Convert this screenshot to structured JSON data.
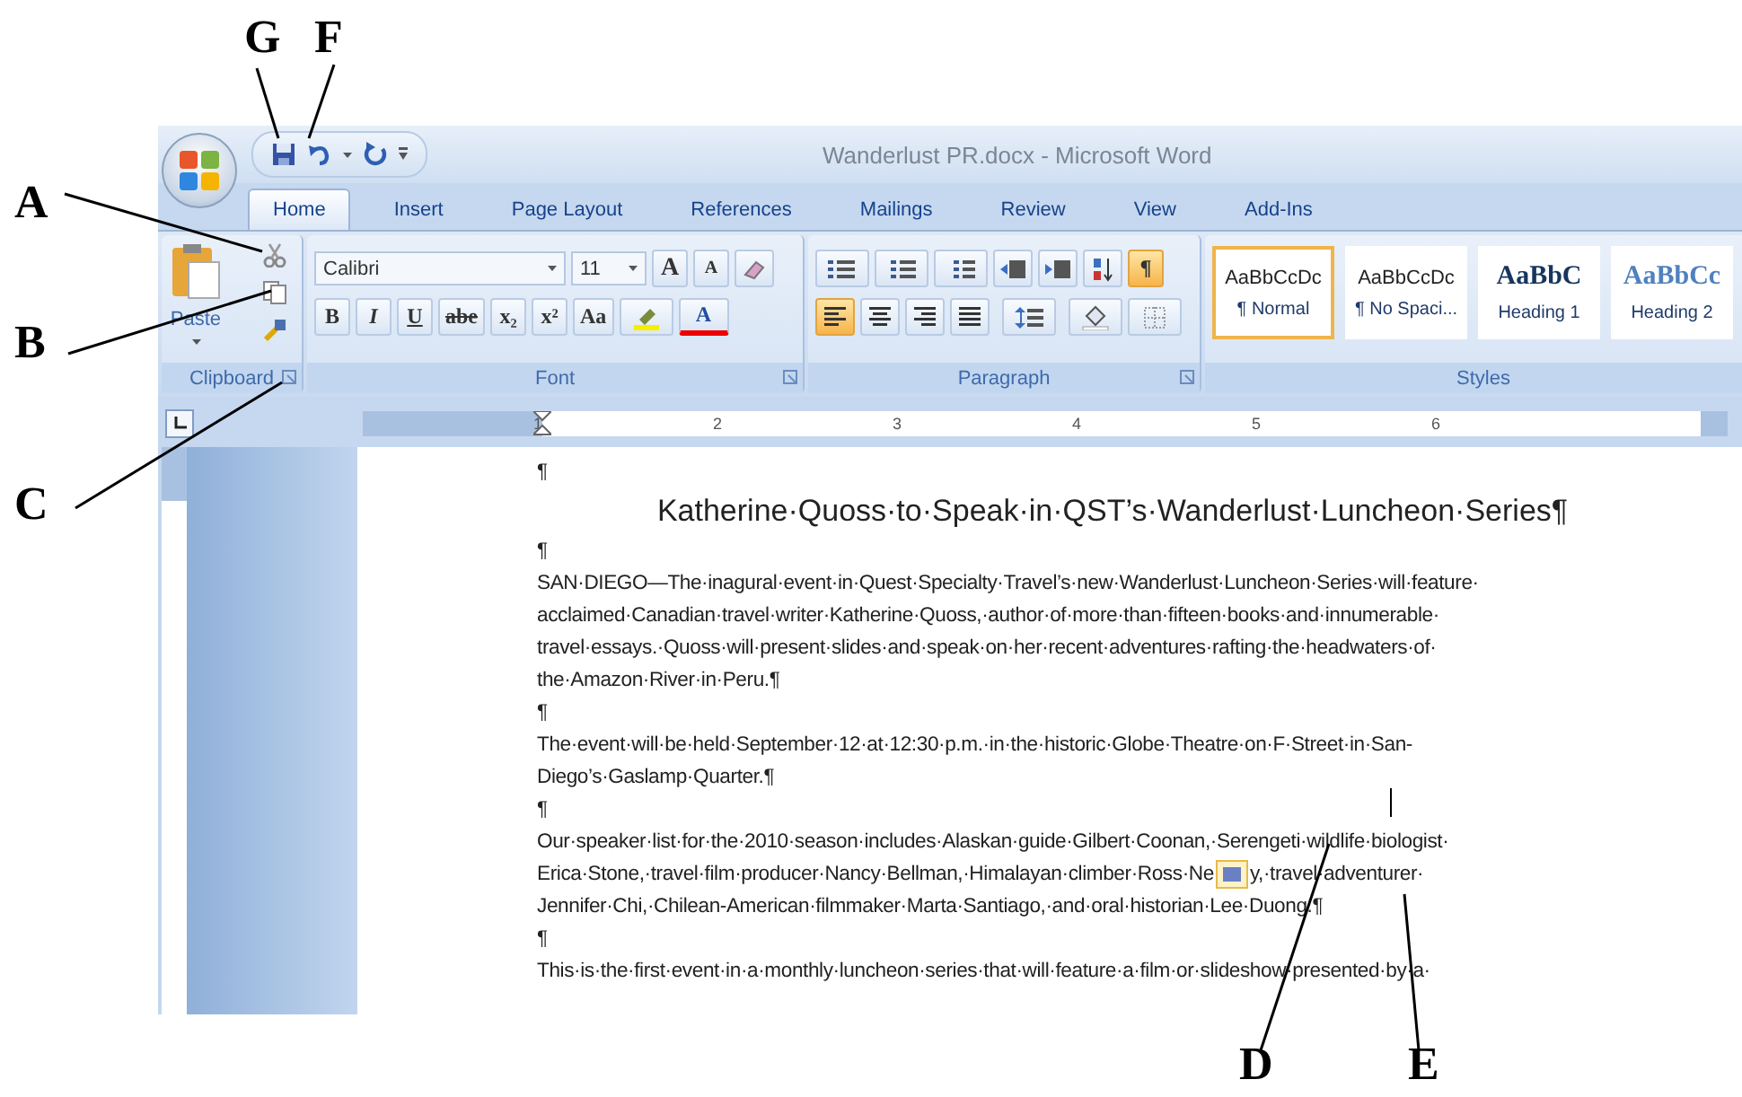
{
  "callouts": [
    {
      "letter": "G"
    },
    {
      "letter": "F"
    },
    {
      "letter": "A"
    },
    {
      "letter": "B"
    },
    {
      "letter": "C"
    },
    {
      "letter": "D"
    },
    {
      "letter": "E"
    }
  ],
  "window": {
    "title": "Wanderlust PR.docx - Microsoft Word"
  },
  "tabs": [
    {
      "label": "Home",
      "selected": true
    },
    {
      "label": "Insert",
      "selected": false
    },
    {
      "label": "Page Layout",
      "selected": false
    },
    {
      "label": "References",
      "selected": false
    },
    {
      "label": "Mailings",
      "selected": false
    },
    {
      "label": "Review",
      "selected": false
    },
    {
      "label": "View",
      "selected": false
    },
    {
      "label": "Add-Ins",
      "selected": false
    }
  ],
  "clipboard": {
    "label": "Clipboard",
    "paste_label": "Paste"
  },
  "font": {
    "label": "Font",
    "font_name": "Calibri",
    "font_size": "11",
    "size_buttons": [
      "A",
      "A"
    ],
    "format_buttons": [
      "B",
      "I",
      "U",
      "abe",
      "x₂",
      "x²",
      "Aa"
    ],
    "color_button": "A"
  },
  "paragraph": {
    "label": "Paragraph",
    "show_marks": {
      "label": "¶",
      "on": true
    },
    "alignment": [
      {
        "selected": true
      },
      {
        "selected": false
      },
      {
        "selected": false
      },
      {
        "selected": false
      }
    ]
  },
  "styles": {
    "label": "Styles",
    "items": [
      {
        "preview": "AaBbCcDc",
        "name": "¶ Normal",
        "kind": "body",
        "selected": true
      },
      {
        "preview": "AaBbCcDc",
        "name": "¶ No Spaci...",
        "kind": "body",
        "selected": false
      },
      {
        "preview": "AaBbC",
        "name": "Heading 1",
        "kind": "heading",
        "selected": false
      },
      {
        "preview": "AaBbCc",
        "name": "Heading 2",
        "kind": "heading2",
        "selected": false
      }
    ]
  },
  "ruler": {
    "marks": [
      "1",
      "2",
      "3",
      "4",
      "5",
      "6"
    ]
  },
  "document": {
    "paragraphs": [
      {
        "kind": "mark",
        "lines": [
          {
            "text": "¶"
          }
        ]
      },
      {
        "kind": "title",
        "lines": [
          {
            "text": "Katherine·Quoss·to·Speak·in·QST’s·Wanderlust·Luncheon·Series¶"
          }
        ]
      },
      {
        "kind": "mark",
        "lines": [
          {
            "text": "¶"
          }
        ]
      },
      {
        "kind": "body",
        "lines": [
          {
            "text": "SAN·DIEGO—The·inagural·event·in·Quest·Specialty·Travel’s·new·Wanderlust·Luncheon·Series·will·feature·"
          },
          {
            "text": "acclaimed·Canadian·travel·writer·Katherine·Quoss,·author·of·more·than·fifteen·books·and·innumerable·"
          },
          {
            "text": "travel·essays.·Quoss·will·present·slides·and·speak·on·her·recent·adventures·rafting·the·headwaters·of·"
          },
          {
            "text": "the·Amazon·River·in·Peru.¶"
          }
        ]
      },
      {
        "kind": "mark",
        "lines": [
          {
            "text": "¶"
          }
        ]
      },
      {
        "kind": "body",
        "lines": [
          {
            "text": "The·event·will·be·held·September·12·at·12:30·p.m.·in·the·historic·Globe·Theatre·on·F·Street·in·San-"
          },
          {
            "text": "Diego’s·Gaslamp·Quarter.¶"
          }
        ]
      },
      {
        "kind": "mark",
        "lines": [
          {
            "text": "¶"
          }
        ]
      },
      {
        "kind": "body",
        "lines": [
          {
            "text": "Our·speaker·list·for·the·2010·season·includes·Alaskan·guide·Gilbert·Coonan,·Serengeti·wildlife·biologist·"
          },
          {
            "text": "Erica·Stone,·travel·film·producer·Nancy·Bellman,·Himalayan·climber·Ross·Ne",
            "after_icon": "y,·travel·adventurer·"
          },
          {
            "text": "Jennifer·Chi,·Chilean-American·filmmaker·Marta·Santiago,·and·oral·historian·Lee·Duong.¶"
          }
        ]
      },
      {
        "kind": "mark",
        "lines": [
          {
            "text": "¶"
          }
        ]
      },
      {
        "kind": "body",
        "lines": [
          {
            "text": "This·is·the·first·event·in·a·monthly·luncheon·series·that·will·feature·a·film·or·slideshow·presented·by·a·"
          }
        ]
      }
    ]
  }
}
